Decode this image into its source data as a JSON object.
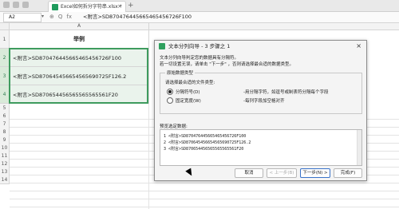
{
  "tabbar": {
    "file_tab": "Excel如何拆分字符串.xlsx *",
    "add_tab": "+",
    "close_tab": "×"
  },
  "formula_bar": {
    "name_box": "A2",
    "name_box_arrow": "▾",
    "fx_btns": [
      "⊕",
      "Q",
      "fx"
    ],
    "formula": "<附言>SD870476445665465456726F100"
  },
  "sheet": {
    "column_header": "A",
    "rows": [
      {
        "num": "1",
        "value": "举例"
      },
      {
        "num": "2",
        "value": "<附言>SD870476445665465456726F100"
      },
      {
        "num": "3",
        "value": "<附言>SD870645456654565690725F126.2"
      },
      {
        "num": "4",
        "value": "<附言>SD870654456565565565561F20"
      }
    ],
    "empty_rows": [
      "5",
      "6",
      "7",
      "8",
      "9",
      "10",
      "11",
      "12",
      "13",
      "14"
    ]
  },
  "dialog": {
    "title": "文本分列向导 - 3 步骤之 1",
    "close": "×",
    "intro_line1": "文本分列向导判定您的数据具有分隔符。",
    "intro_line2": "若一切设置无误，请单击 \"下一步\" ，否则请选择最合适的数据类型。",
    "group_legend": "原始数据类型",
    "group_prompt": "请选择最合适的文件类型:",
    "options": [
      {
        "label": "分隔符号(D)",
        "desc": "-用分隔字符，如逗号或制表符分隔每个字段",
        "selected": true
      },
      {
        "label": "固定宽度(W)",
        "desc": "-每列字段加空格对齐",
        "selected": false
      }
    ],
    "preview_label": "预览选定数据:",
    "preview_rows": [
      "1 <附言>SD870476445665465456726F100",
      "2 <附言>SD870645456654565690725F126.2",
      "3 <附言>SD870654456565565565561F20"
    ],
    "buttons": {
      "cancel": "取消",
      "back": "< 上一步(B)",
      "next": "下一步(N) >",
      "finish": "完成(F)"
    }
  },
  "colors": {
    "brand_green": "#2ea05e",
    "selection_border": "#3e9b5e",
    "selection_fill": "#eaf3ec"
  },
  "icons": [
    "excel-file-icon",
    "app-icon",
    "close-icon",
    "radio-icon",
    "mouse-cursor-icon"
  ]
}
